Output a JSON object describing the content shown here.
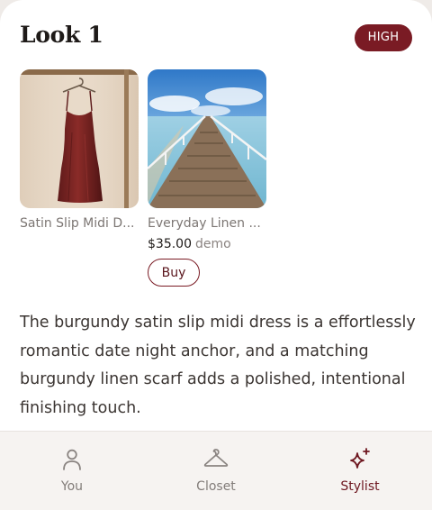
{
  "look": {
    "title": "Look 1",
    "badge": "HIGH",
    "description": "The burgundy satin slip midi dress is a effortlessly romantic date night anchor, and a matching burgundy linen scarf adds a polished, intentional finishing touch."
  },
  "products": [
    {
      "name": "Satin Slip Midi D...",
      "image": "burgundy-satin-dress-photo"
    },
    {
      "name": "Everyday Linen ...",
      "image": "wooden-pier-photo",
      "price": "$35.00",
      "price_note": "demo",
      "buy_label": "Buy"
    }
  ],
  "nav": {
    "items": [
      {
        "label": "You",
        "icon": "person-icon",
        "active": false
      },
      {
        "label": "Closet",
        "icon": "hanger-icon",
        "active": false
      },
      {
        "label": "Stylist",
        "icon": "sparkle-icon",
        "active": true
      }
    ]
  },
  "colors": {
    "accent": "#7a1b24",
    "background": "#ffffff",
    "nav_background": "#f6f3f1"
  }
}
